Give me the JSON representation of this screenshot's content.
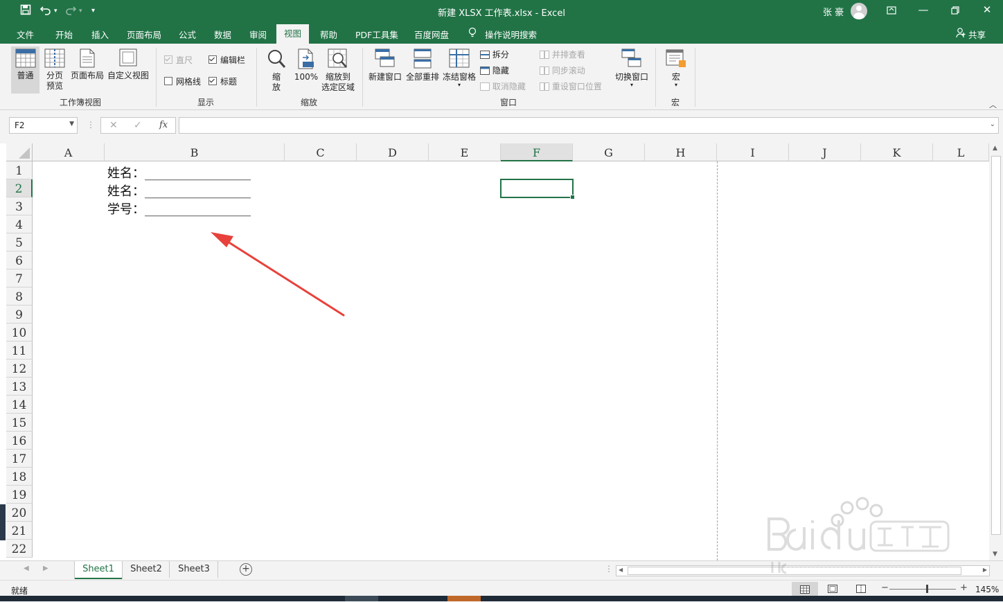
{
  "window": {
    "title": "新建 XLSX 工作表.xlsx  -  Excel",
    "user": "张 豪",
    "share": "共享",
    "search_hint": "操作说明搜索"
  },
  "menu": [
    "文件",
    "开始",
    "插入",
    "页面布局",
    "公式",
    "数据",
    "审阅",
    "视图",
    "帮助",
    "PDF工具集",
    "百度网盘"
  ],
  "ribbon": {
    "workbook_views": {
      "label": "工作簿视图",
      "normal": "普通",
      "page_break_1": "分页",
      "page_break_2": "预览",
      "page_layout": "页面布局",
      "custom_views": "自定义视图"
    },
    "show": {
      "label": "显示",
      "ruler": "直尺",
      "formula_bar": "编辑栏",
      "gridlines": "网格线",
      "headings": "标题"
    },
    "zoom": {
      "label": "缩放",
      "zoom_1": "缩",
      "zoom_2": "放",
      "hundred": "100%",
      "to_sel_1": "缩放到",
      "to_sel_2": "选定区域"
    },
    "window": {
      "label": "窗口",
      "new_window": "新建窗口",
      "arrange_all": "全部重排",
      "freeze_panes": "冻结窗格",
      "split": "拆分",
      "hide": "隐藏",
      "unhide": "取消隐藏",
      "side_by_side": "并排查看",
      "sync_scroll": "同步滚动",
      "reset_position": "重设窗口位置",
      "switch_windows": "切换窗口"
    },
    "macros": {
      "label": "宏",
      "button": "宏"
    }
  },
  "formula_bar": {
    "name_box": "F2",
    "cancel": "✕",
    "enter": "✓",
    "fx": "fx",
    "value": ""
  },
  "columns": [
    "A",
    "B",
    "C",
    "D",
    "E",
    "F",
    "G",
    "H",
    "I",
    "J",
    "K",
    "L"
  ],
  "rows": [
    "1",
    "2",
    "3",
    "4",
    "5",
    "6",
    "7",
    "8",
    "9",
    "10",
    "11",
    "12",
    "13",
    "14",
    "15",
    "16",
    "17",
    "18",
    "19",
    "20",
    "21",
    "22"
  ],
  "cells": {
    "B1": "姓名：_________________",
    "B2": "姓名：_________________",
    "B3": "学号：_________________"
  },
  "selected_cell": "F2",
  "sheets": [
    "Sheet1",
    "Sheet2",
    "Sheet3"
  ],
  "active_sheet": "Sheet1",
  "status": {
    "mode": "就绪",
    "zoom": "145%"
  },
  "watermark": "Baidu经验 jingyan.baidu.com",
  "colors": {
    "excel_green": "#217346",
    "arrow_red": "#e8413b"
  }
}
